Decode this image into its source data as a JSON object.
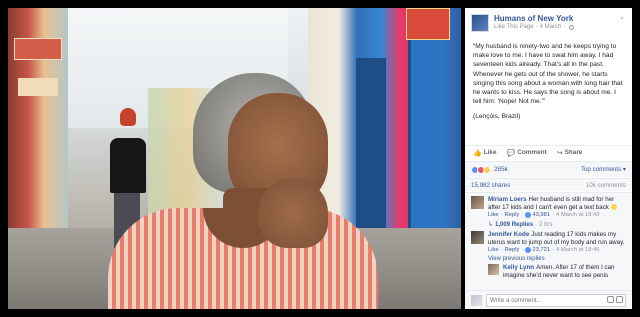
{
  "page": {
    "name": "Humans of New York",
    "like_link": "Like This Page",
    "date": "4 March"
  },
  "post": {
    "paragraphs": [
      "“My husband is ninety-two and he keeps trying to make love to me. I have to swat him away. I had seventeen kids already. That’s all in the past. Whenever he gets out of the shower, he starts singing this song about a woman with long hair that he wants to kiss. He says the song is about me. I tell him: ‘Nope! Not me.’”",
      "(Lençóis, Brazil)"
    ]
  },
  "actions": {
    "like": "Like",
    "comment": "Comment",
    "share": "Share"
  },
  "reactions": {
    "count": "285k",
    "top_comments": "Top comments ▾"
  },
  "shares": {
    "shares": "15,982 shares",
    "comments": "10k comments"
  },
  "comments": [
    {
      "name": "Miriam Loers",
      "text": "Her husband is still mad for her after 17 kids and I can't even get a text back",
      "like": "Like",
      "reply": "Reply",
      "likes": "43,981",
      "time": "4 March at 18:43",
      "replies": "1,009 Replies",
      "replies_time": "2 hrs"
    },
    {
      "name": "Jennifer Kode",
      "text": "Just reading 17 kids makes my uterus want to jump out of my body and run away.",
      "like": "Like",
      "reply": "Reply",
      "likes": "23,721",
      "time": "4 March at 18:45",
      "view_previous": "View previous replies",
      "reply_item": {
        "name": "Kelly Lynn",
        "text": "Amen. After 17 of them I can imagine she'd never want to see penis"
      }
    }
  ],
  "write_comment": {
    "placeholder": "Write a comment..."
  },
  "colors": {
    "link": "#365899",
    "secondary": "#90949c",
    "panel_bg": "#f6f7f9"
  }
}
